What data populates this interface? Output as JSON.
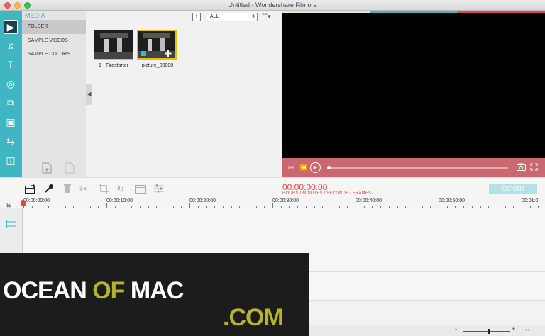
{
  "window": {
    "title": "Untitled - Wondershare Filmora"
  },
  "left_toolbar": {
    "tools": [
      {
        "icon": "media-icon",
        "glyph": "▶"
      },
      {
        "icon": "music-icon",
        "glyph": "♫"
      },
      {
        "icon": "text-icon",
        "glyph": "T"
      },
      {
        "icon": "filter-icon",
        "glyph": "◎"
      },
      {
        "icon": "overlay-icon",
        "glyph": "⧉"
      },
      {
        "icon": "elements-icon",
        "glyph": "▣"
      },
      {
        "icon": "transition-icon",
        "glyph": "⇆"
      },
      {
        "icon": "split-screen-icon",
        "glyph": "◫"
      }
    ],
    "accent": "#3fb6c2"
  },
  "media_sidebar": {
    "heading": "MEDIA",
    "items": [
      {
        "label": "FOLDER",
        "selected": true
      },
      {
        "label": "SAMPLE VIDEOS",
        "selected": false
      },
      {
        "label": "SAMPLE COLORS",
        "selected": false
      }
    ]
  },
  "browser": {
    "add_glyph": "+",
    "filter_value": "ALL",
    "filter_arrow": "⇕",
    "grid_glyph": "☷▾",
    "collapse_glyph": "◀",
    "items": [
      {
        "label": "1 - Firestarter",
        "selected": false
      },
      {
        "label": "picture_00000",
        "selected": true
      }
    ]
  },
  "preview": {
    "top_colors": [
      "#e9e4d4",
      "#3fb6c2",
      "#e0454a"
    ],
    "controls_color": "#c9686e"
  },
  "edit_toolbar": {
    "timecode": "00:00:00:00",
    "timecode_caption": "HOURS / MINUTES / SECONDS / FRAMES",
    "export_label": "EXPORT"
  },
  "ruler": {
    "labels": [
      "00:00:00:00",
      "00:00:10:00",
      "00:00:20:00",
      "00:00:30:00",
      "00:00:40:00",
      "00:00:50:00",
      "00:01:0"
    ]
  },
  "watermark": {
    "part1": "OCEAN ",
    "part2": "OF",
    "part3": " MAC",
    "part4": ".COM"
  },
  "bottombar": {
    "minus": "-",
    "plus": "+",
    "fit": "↔"
  }
}
